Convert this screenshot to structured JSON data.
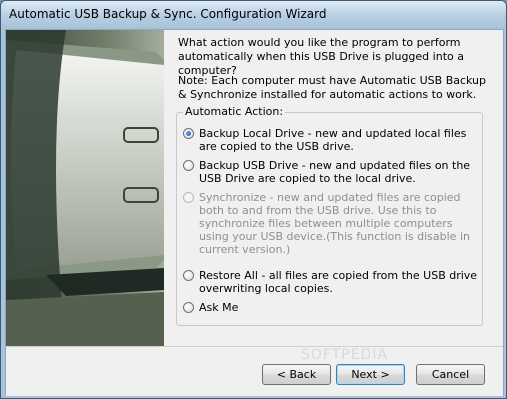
{
  "window": {
    "title": "Automatic USB Backup & Sync. Configuration Wizard"
  },
  "content": {
    "intro": "What action would you like the program to perform automatically when this USB Drive is plugged into a computer?",
    "note": "Note: Each computer must have Automatic USB Backup & Synchronize installed for automatic actions to work.",
    "group_label": "Automatic Action:",
    "options": [
      {
        "label": "Backup Local Drive - new and updated local files are copied to the USB drive.",
        "checked": true,
        "enabled": true
      },
      {
        "label": "Backup USB Drive - new and updated files on the USB Drive are copied to the local drive.",
        "checked": false,
        "enabled": true
      },
      {
        "label": "Synchronize -  new and updated files are copied both to and from the USB drive. Use this to synchronize files between multiple computers using your USB device.(This function is disable in current version.)",
        "checked": false,
        "enabled": false
      },
      {
        "label": "Restore All - all files are copied from the USB drive overwriting local copies.",
        "checked": false,
        "enabled": true
      },
      {
        "label": "Ask Me",
        "checked": false,
        "enabled": true
      }
    ]
  },
  "buttons": {
    "back": "< Back",
    "next": "Next >",
    "cancel": "Cancel"
  },
  "watermark": "SOFTPEDIA",
  "colors": {
    "titlebar": "#b8d0e4",
    "dialog_bg": "#f0f0f0",
    "disabled_text": "#8f8f8f",
    "default_button_border": "#3c7fb1"
  }
}
